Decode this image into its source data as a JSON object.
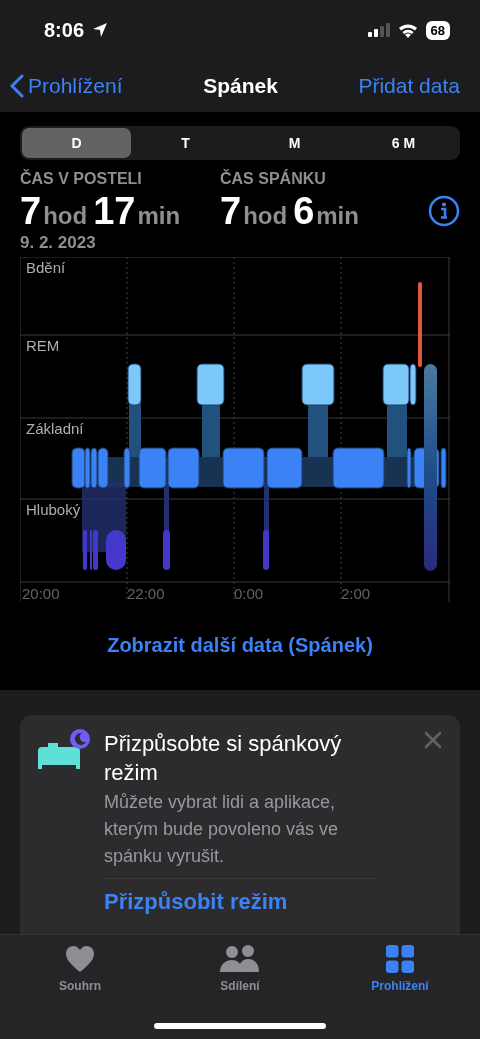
{
  "status_bar": {
    "time": "8:06",
    "battery": "68"
  },
  "nav": {
    "back": "Prohlížení",
    "title": "Spánek",
    "action": "Přidat data"
  },
  "segments": [
    {
      "label": "D",
      "selected": true
    },
    {
      "label": "T",
      "selected": false
    },
    {
      "label": "M",
      "selected": false
    },
    {
      "label": "6 M",
      "selected": false
    }
  ],
  "stats": [
    {
      "label": "ČAS V POSTELI",
      "parts": [
        {
          "value": "7",
          "unit": "hod"
        },
        {
          "value": "17",
          "unit": "min"
        }
      ]
    },
    {
      "label": "ČAS SPÁNKU",
      "parts": [
        {
          "value": "7",
          "unit": "hod"
        },
        {
          "value": "6",
          "unit": "min"
        }
      ]
    }
  ],
  "date": "9. 2. 2023",
  "chart": {
    "stages": [
      "Bdění",
      "REM",
      "Základní",
      "Hluboký"
    ],
    "xticks": [
      "20:00",
      "22:00",
      "0:00",
      "2:00"
    ]
  },
  "more_link": "Zobrazit další data (Spánek)",
  "card": {
    "title": "Přizpůsobte si spánkový režim",
    "body": "Můžete vybrat lidi a aplikace, kterým bude povoleno vás ve spánku vyrušit.",
    "action": "Přizpůsobit režim"
  },
  "tabs": [
    {
      "label": "Souhrn",
      "kind": "heart",
      "selected": false
    },
    {
      "label": "Sdílení",
      "kind": "people",
      "selected": false
    },
    {
      "label": "Prohlížení",
      "kind": "grid",
      "selected": true
    }
  ]
}
